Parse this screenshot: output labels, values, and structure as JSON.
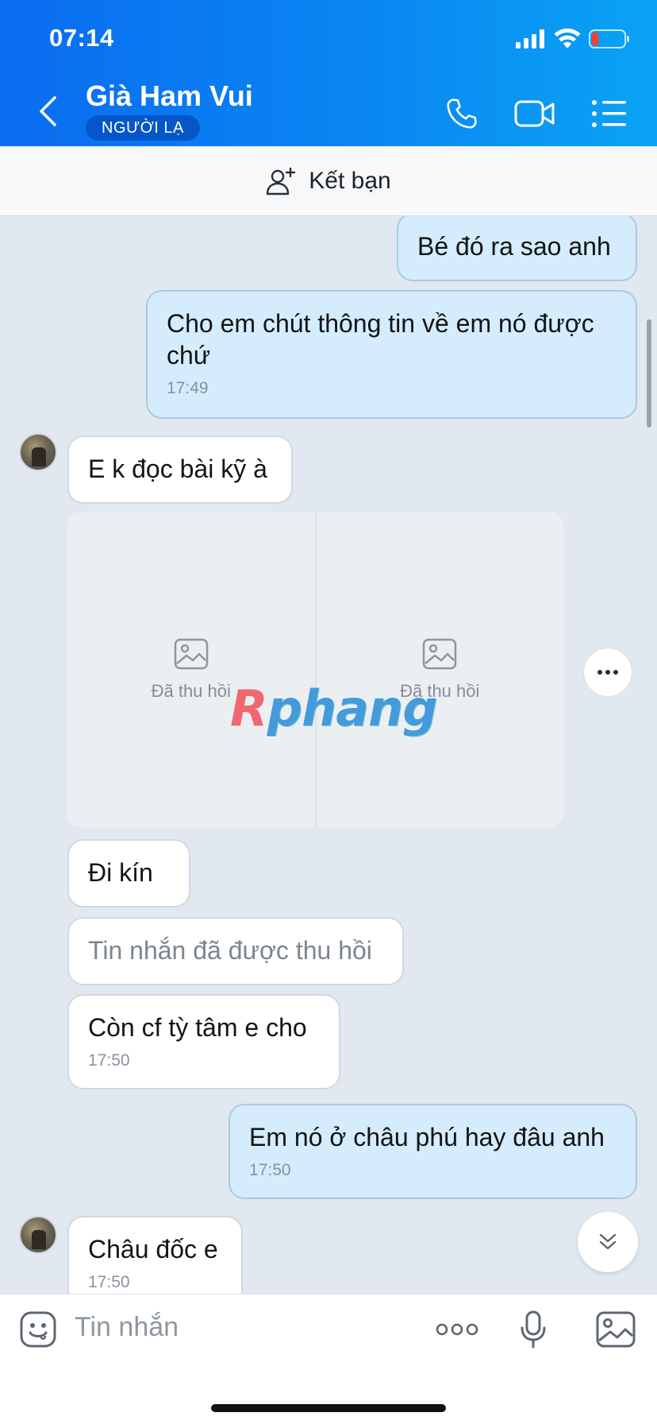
{
  "status_bar": {
    "time": "07:14"
  },
  "header": {
    "contact_name": "Già Ham Vui",
    "badge": "NGƯỜI LẠ",
    "icons": [
      "back-icon",
      "phone-icon",
      "video-call-icon",
      "menu-list-icon"
    ]
  },
  "add_friend": {
    "label": "Kết bạn"
  },
  "messages": [
    {
      "side": "out",
      "text": "Bé đó ra sao anh"
    },
    {
      "side": "out",
      "text": "Cho em chút thông tin về em nó được chứ",
      "time": "17:49"
    },
    {
      "side": "in",
      "text": "E k đọc bài kỹ à"
    },
    {
      "side": "in",
      "type": "photos",
      "photos": [
        "Đã thu hồi",
        "Đã thu hồi"
      ]
    },
    {
      "side": "in",
      "text": "Đi kín"
    },
    {
      "side": "in",
      "text": "Tin nhắn đã được thu hồi",
      "recalled": true
    },
    {
      "side": "in",
      "text": "Còn cf tỳ tâm e cho",
      "time": "17:50"
    },
    {
      "side": "out",
      "text": "Em nó ở châu phú hay đâu anh",
      "time": "17:50"
    },
    {
      "side": "in",
      "text": "Châu đốc e",
      "time": "17:50"
    }
  ],
  "watermark": {
    "first": "R",
    "rest": "phang"
  },
  "input": {
    "placeholder": "Tin nhắn"
  },
  "colors": {
    "header_start": "#0a6cf0",
    "header_end": "#0aa3f4",
    "out_bubble": "#d4ecfb",
    "in_bubble": "#ffffff",
    "chat_bg": "#e2e8f0"
  }
}
